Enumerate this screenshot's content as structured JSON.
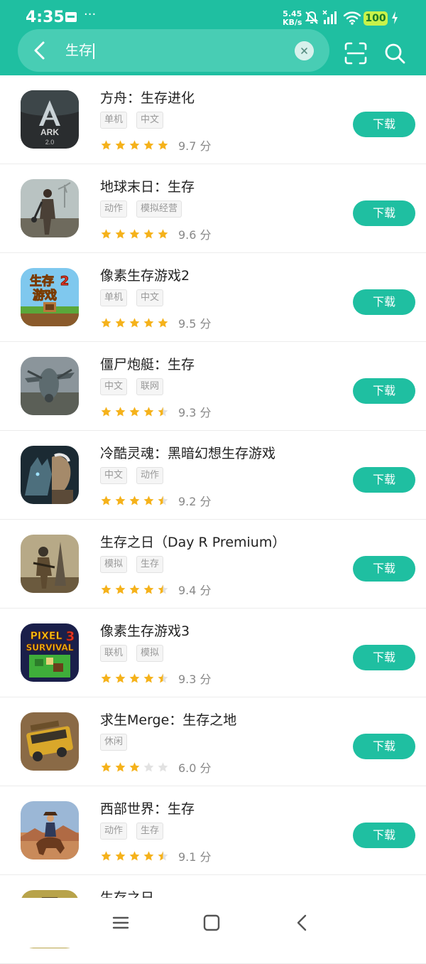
{
  "status_bar": {
    "time": "4:35",
    "net_speed": "5.45",
    "net_unit": "KB/s",
    "battery": "100"
  },
  "search": {
    "query": "生存"
  },
  "buttons": {
    "download": "下载"
  },
  "score_suffix": "分",
  "apps": [
    {
      "title": "方舟：生存进化",
      "tags": [
        "单机",
        "中文"
      ],
      "stars": 5,
      "score": "9.7"
    },
    {
      "title": "地球末日：生存",
      "tags": [
        "动作",
        "模拟经营"
      ],
      "stars": 5,
      "score": "9.6"
    },
    {
      "title": "像素生存游戏2",
      "tags": [
        "单机",
        "中文"
      ],
      "stars": 5,
      "score": "9.5"
    },
    {
      "title": "僵尸炮艇：生存",
      "tags": [
        "中文",
        "联网"
      ],
      "stars": 4.5,
      "score": "9.3"
    },
    {
      "title": "冷酷灵魂：黑暗幻想生存游戏",
      "tags": [
        "中文",
        "动作"
      ],
      "stars": 4.5,
      "score": "9.2"
    },
    {
      "title": "生存之日（Day R Premium）",
      "tags": [
        "模拟",
        "生存"
      ],
      "stars": 4.5,
      "score": "9.4"
    },
    {
      "title": "像素生存游戏3",
      "tags": [
        "联机",
        "模拟"
      ],
      "stars": 4.5,
      "score": "9.3"
    },
    {
      "title": "求生Merge：生存之地",
      "tags": [
        "休闲"
      ],
      "stars": 3,
      "score": "6.0"
    },
    {
      "title": "西部世界：生存",
      "tags": [
        "动作",
        "生存"
      ],
      "stars": 4.5,
      "score": "9.1"
    },
    {
      "title": "生存之日",
      "tags": [],
      "stars": 0,
      "score": ""
    }
  ],
  "icons": [
    "ark-icon",
    "survivor-icon",
    "pixel-survival-2-icon",
    "gunship-icon",
    "wolf-warrior-icon",
    "day-r-icon",
    "pixel-survival-3-icon",
    "bus-icon",
    "cowboy-icon",
    "day-r-partial-icon"
  ],
  "colors": {
    "accent": "#1fbfa1",
    "star": "#f5b21b",
    "star_empty": "#e2e2e2"
  },
  "icon_text": {
    "ark": "ARK",
    "ark_ver": "2.0",
    "pixel2_a": "生存",
    "pixel2_num": "2",
    "pixel2_b": "游戏",
    "pixel3_a": "PIXEL",
    "pixel3_b": "SURVIVAL",
    "pixel3_num": "3"
  }
}
